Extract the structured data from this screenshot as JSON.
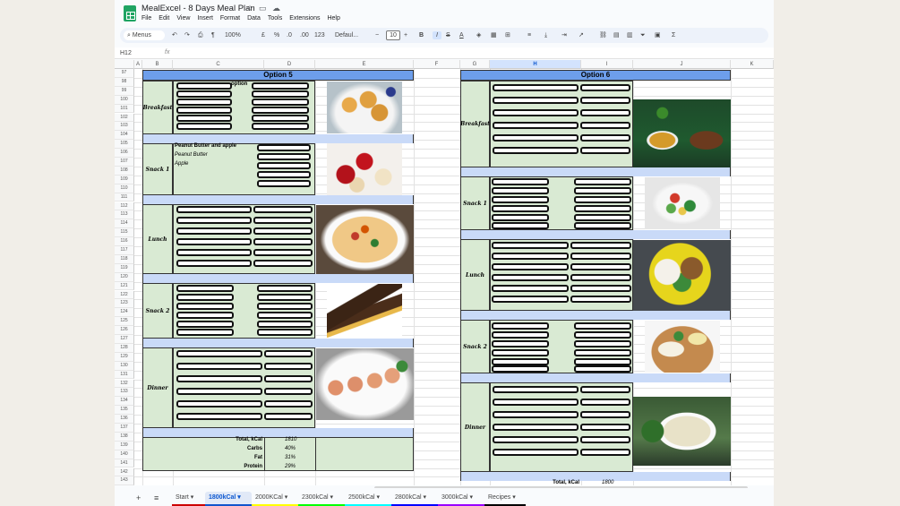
{
  "app": {
    "title": "MealExcel - 8 Days Meal Plan",
    "menu": [
      "File",
      "Edit",
      "View",
      "Insert",
      "Format",
      "Data",
      "Tools",
      "Extensions",
      "Help"
    ]
  },
  "toolbar": {
    "search": "Menus",
    "zoom": "100%",
    "currency": "£",
    "percent": "%",
    "dec_less": ".0",
    "dec_more": ".00",
    "number_format": "123",
    "font": "Defaul...",
    "font_size": "10",
    "bold": "B",
    "italic": "I",
    "strike": "S",
    "text_color": "A",
    "sigma": "Σ"
  },
  "formula_bar": {
    "name_box": "H12",
    "fx": "fx"
  },
  "columns": [
    "A",
    "B",
    "C",
    "D",
    "E",
    "F",
    "G",
    "H",
    "I",
    "J",
    "K"
  ],
  "selected_column": "H",
  "rows": [
    "97",
    "98",
    "99",
    "100",
    "101",
    "102",
    "103",
    "104",
    "105",
    "106",
    "107",
    "108",
    "109",
    "110",
    "111",
    "112",
    "113",
    "114",
    "115",
    "116",
    "117",
    "118",
    "119",
    "120",
    "121",
    "122",
    "123",
    "124",
    "125",
    "126",
    "127",
    "128",
    "129",
    "130",
    "131",
    "132",
    "133",
    "134",
    "135",
    "136",
    "137",
    "138",
    "139",
    "140",
    "141",
    "142",
    "143"
  ],
  "option5": {
    "header": "Option 5",
    "partial_text": "option",
    "snack1_lines": [
      "Peanut Butter and apple",
      "Peanut Butter",
      "Apple"
    ],
    "meals": [
      "Breakfast",
      "Snack 1",
      "Lunch",
      "Snack 2",
      "Dinner"
    ],
    "totals": [
      {
        "label": "Total, kCal",
        "value": "1810"
      },
      {
        "label": "Carbs",
        "value": "40%"
      },
      {
        "label": "Fat",
        "value": "31%"
      },
      {
        "label": "Protein",
        "value": "29%"
      }
    ]
  },
  "option6": {
    "header": "Option 6",
    "meals": [
      "Breakfast",
      "Snack 1",
      "Lunch",
      "Snack 2",
      "Dinner"
    ],
    "partial_total_label": "Total, kCal",
    "partial_total_value": "1800"
  },
  "tabs": [
    {
      "label": "Start",
      "color": "#cc0000"
    },
    {
      "label": "1800kCal",
      "color": "#1155cc"
    },
    {
      "label": "2000KCal",
      "color": "#ffff00"
    },
    {
      "label": "2300kCal",
      "color": "#00ff00"
    },
    {
      "label": "2500kCal",
      "color": "#00ffff"
    },
    {
      "label": "2800kCal",
      "color": "#0000ff"
    },
    {
      "label": "3000kCal",
      "color": "#9900ff"
    },
    {
      "label": "Recipes",
      "color": "#000000"
    }
  ],
  "active_tab": "1800kCal"
}
